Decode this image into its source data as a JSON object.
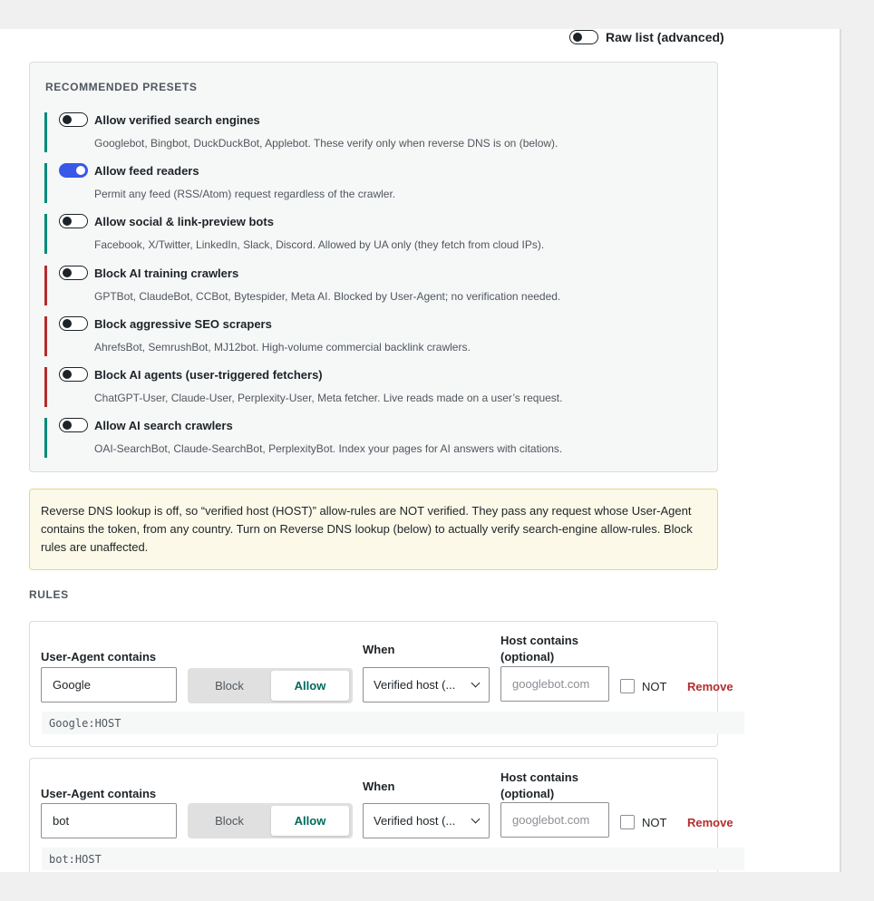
{
  "header": {
    "raw_list_label": "Raw list (advanced)",
    "raw_list_on": false
  },
  "presets": {
    "title": "RECOMMENDED PRESETS",
    "items": [
      {
        "title": "Allow verified search engines",
        "desc": "Googlebot, Bingbot, DuckDuckBot, Applebot. These verify only when reverse DNS is on (below).",
        "on": false,
        "kind": "allow"
      },
      {
        "title": "Allow feed readers",
        "desc": "Permit any feed (RSS/Atom) request regardless of the crawler.",
        "on": true,
        "kind": "allow"
      },
      {
        "title": "Allow social & link-preview bots",
        "desc": "Facebook, X/Twitter, LinkedIn, Slack, Discord. Allowed by UA only (they fetch from cloud IPs).",
        "on": false,
        "kind": "allow"
      },
      {
        "title": "Block AI training crawlers",
        "desc": "GPTBot, ClaudeBot, CCBot, Bytespider, Meta AI. Blocked by User-Agent; no verification needed.",
        "on": false,
        "kind": "block"
      },
      {
        "title": "Block aggressive SEO scrapers",
        "desc": "AhrefsBot, SemrushBot, MJ12bot. High-volume commercial backlink crawlers.",
        "on": false,
        "kind": "block"
      },
      {
        "title": "Block AI agents (user-triggered fetchers)",
        "desc": "ChatGPT-User, Claude-User, Perplexity-User, Meta fetcher. Live reads made on a user’s request.",
        "on": false,
        "kind": "block"
      },
      {
        "title": "Allow AI search crawlers",
        "desc": "OAI-SearchBot, Claude-SearchBot, PerplexityBot. Index your pages for AI answers with citations.",
        "on": false,
        "kind": "allow"
      }
    ]
  },
  "notice": {
    "text": "Reverse DNS lookup is off, so “verified host (HOST)” allow-rules are NOT verified. They pass any request whose User-Agent contains the token, from any country. Turn on Reverse DNS lookup (below) to actually verify search-engine allow-rules. Block rules are unaffected."
  },
  "rules": {
    "title": "RULES",
    "labels": {
      "ua": "User-Agent contains",
      "when": "When",
      "host_line1": "Host contains",
      "host_line2": "(optional)",
      "block": "Block",
      "allow": "Allow",
      "not": "NOT",
      "remove": "Remove",
      "host_placeholder": "googlebot.com"
    },
    "items": [
      {
        "ua": "Google",
        "action": "Allow",
        "when": "Verified host (...",
        "host": "",
        "not": false,
        "preview": "Google:HOST"
      },
      {
        "ua": "bot",
        "action": "Allow",
        "when": "Verified host (...",
        "host": "",
        "not": false,
        "preview": "bot:HOST"
      }
    ]
  },
  "colors": {
    "allow_accent": "#008a7a",
    "block_accent": "#b32d2e",
    "toggle_on": "#3858e9",
    "remove": "#b32d2e"
  }
}
